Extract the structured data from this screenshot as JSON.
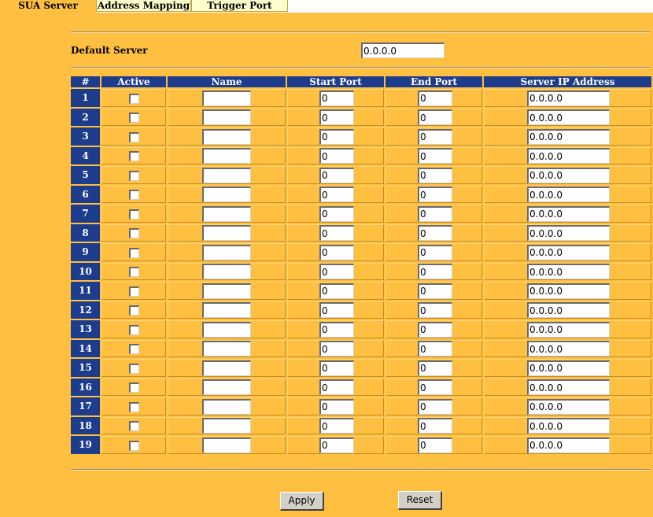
{
  "tabs": [
    {
      "label": "SUA Server",
      "active": true
    },
    {
      "label": "Address Mapping",
      "active": false
    },
    {
      "label": "Trigger Port",
      "active": false
    }
  ],
  "default_server": {
    "label": "Default Server",
    "value": "0.0.0.0"
  },
  "table": {
    "headers": [
      "#",
      "Active",
      "Name",
      "Start Port",
      "End Port",
      "Server IP Address"
    ],
    "rows": [
      {
        "num": "1",
        "active": false,
        "name": "",
        "start_port": "0",
        "end_port": "0",
        "server_ip": "0.0.0.0"
      },
      {
        "num": "2",
        "active": false,
        "name": "",
        "start_port": "0",
        "end_port": "0",
        "server_ip": "0.0.0.0"
      },
      {
        "num": "3",
        "active": false,
        "name": "",
        "start_port": "0",
        "end_port": "0",
        "server_ip": "0.0.0.0"
      },
      {
        "num": "4",
        "active": false,
        "name": "",
        "start_port": "0",
        "end_port": "0",
        "server_ip": "0.0.0.0"
      },
      {
        "num": "5",
        "active": false,
        "name": "",
        "start_port": "0",
        "end_port": "0",
        "server_ip": "0.0.0.0"
      },
      {
        "num": "6",
        "active": false,
        "name": "",
        "start_port": "0",
        "end_port": "0",
        "server_ip": "0.0.0.0"
      },
      {
        "num": "7",
        "active": false,
        "name": "",
        "start_port": "0",
        "end_port": "0",
        "server_ip": "0.0.0.0"
      },
      {
        "num": "8",
        "active": false,
        "name": "",
        "start_port": "0",
        "end_port": "0",
        "server_ip": "0.0.0.0"
      },
      {
        "num": "9",
        "active": false,
        "name": "",
        "start_port": "0",
        "end_port": "0",
        "server_ip": "0.0.0.0"
      },
      {
        "num": "10",
        "active": false,
        "name": "",
        "start_port": "0",
        "end_port": "0",
        "server_ip": "0.0.0.0"
      },
      {
        "num": "11",
        "active": false,
        "name": "",
        "start_port": "0",
        "end_port": "0",
        "server_ip": "0.0.0.0"
      },
      {
        "num": "12",
        "active": false,
        "name": "",
        "start_port": "0",
        "end_port": "0",
        "server_ip": "0.0.0.0"
      },
      {
        "num": "13",
        "active": false,
        "name": "",
        "start_port": "0",
        "end_port": "0",
        "server_ip": "0.0.0.0"
      },
      {
        "num": "14",
        "active": false,
        "name": "",
        "start_port": "0",
        "end_port": "0",
        "server_ip": "0.0.0.0"
      },
      {
        "num": "15",
        "active": false,
        "name": "",
        "start_port": "0",
        "end_port": "0",
        "server_ip": "0.0.0.0"
      },
      {
        "num": "16",
        "active": false,
        "name": "",
        "start_port": "0",
        "end_port": "0",
        "server_ip": "0.0.0.0"
      },
      {
        "num": "17",
        "active": false,
        "name": "",
        "start_port": "0",
        "end_port": "0",
        "server_ip": "0.0.0.0"
      },
      {
        "num": "18",
        "active": false,
        "name": "",
        "start_port": "0",
        "end_port": "0",
        "server_ip": "0.0.0.0"
      },
      {
        "num": "19",
        "active": false,
        "name": "",
        "start_port": "0",
        "end_port": "0",
        "server_ip": "0.0.0.0"
      }
    ]
  },
  "buttons": {
    "apply": "Apply",
    "reset": "Reset"
  },
  "colors": {
    "background": "#FFBF40",
    "header_blue": "#1E3C8C",
    "tab_inactive": "#FFFFCC"
  }
}
